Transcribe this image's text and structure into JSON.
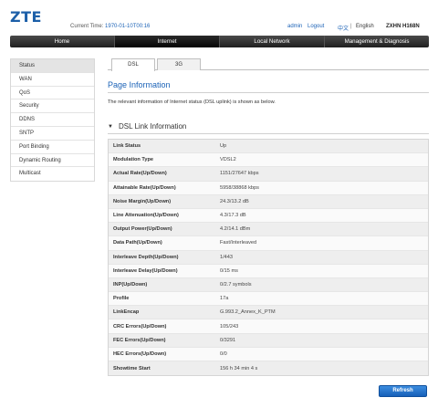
{
  "header": {
    "logo": "ZTE",
    "current_time_label": "Current Time:",
    "current_time": "1970-01-10T00:16",
    "user": "admin",
    "logout": "Logout",
    "lang_cn": "中文",
    "separator": "|",
    "lang_en": "English",
    "model": "ZXHN H168N"
  },
  "nav": [
    "Home",
    "Internet",
    "Local Network",
    "Management & Diagnosis"
  ],
  "sidebar": [
    "Status",
    "WAN",
    "QoS",
    "Security",
    "DDNS",
    "SNTP",
    "Port Binding",
    "Dynamic Routing",
    "Multicast"
  ],
  "tabs": [
    "DSL",
    "3G"
  ],
  "page_title": "Page Information",
  "description": "The relevant information of Internet status (DSL uplink) is shown as below.",
  "section_title": "DSL Link Information",
  "rows": [
    {
      "label": "Link Status",
      "value": "Up"
    },
    {
      "label": "Modulation Type",
      "value": "VDSL2"
    },
    {
      "label": "Actual Rate(Up/Down)",
      "value": "1151/27647 kbps"
    },
    {
      "label": "Attainable Rate(Up/Down)",
      "value": "5958/38868 kbps"
    },
    {
      "label": "Noise Margin(Up/Down)",
      "value": "24.3/13.2 dB"
    },
    {
      "label": "Line Attenuation(Up/Down)",
      "value": "4.3/17.3 dB"
    },
    {
      "label": "Output Power(Up/Down)",
      "value": "4.2/14.1 dBm"
    },
    {
      "label": "Data Path(Up/Down)",
      "value": "Fast/Interleaved"
    },
    {
      "label": "Interleave Depth(Up/Down)",
      "value": "1/443"
    },
    {
      "label": "Interleave Delay(Up/Down)",
      "value": "0/15 ms"
    },
    {
      "label": "INP(Up/Down)",
      "value": "0/2.7 symbols"
    },
    {
      "label": "Profile",
      "value": "17a"
    },
    {
      "label": "LinkEncap",
      "value": "G.993.2_Annex_K_PTM"
    },
    {
      "label": "CRC Errors(Up/Down)",
      "value": "105/243"
    },
    {
      "label": "FEC Errors(Up/Down)",
      "value": "0/3291"
    },
    {
      "label": "HEC Errors(Up/Down)",
      "value": "0/0"
    },
    {
      "label": "Showtime Start",
      "value": "156 h 34 min 4 s"
    }
  ],
  "refresh_label": "Refresh",
  "colors": {
    "accent": "#1c63b7",
    "nav_bg": "#2b2b2b",
    "button": "#1f6fc8"
  }
}
